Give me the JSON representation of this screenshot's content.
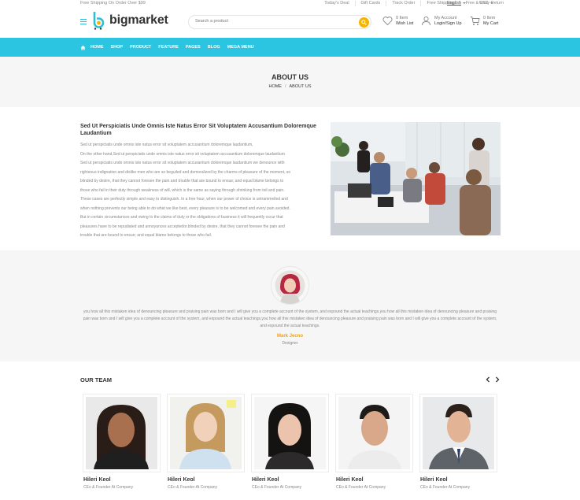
{
  "topbar": {
    "shipping": "Free Shipping On Order Over $99",
    "links": [
      "Today's Deal",
      "Gift Cards",
      "Track Order",
      "Free Shipping",
      "Free & Easy Return"
    ],
    "language": "English",
    "currency": "USD"
  },
  "header": {
    "logo": "bigmarket",
    "search_placeholder": "Search a product",
    "wishlist_count": "0 Item",
    "wishlist_label": "Wish List",
    "account_top": "My Account",
    "account_bottom": "Login/Sign Up",
    "cart_count": "0 Item",
    "cart_label": "My Cart"
  },
  "nav": [
    "HOME",
    "SHOP",
    "PRODUCT",
    "FEATURE",
    "PAGES",
    "BLOG",
    "MEGA MENU"
  ],
  "page": {
    "title": "ABOUT US",
    "breadcrumb_home": "HOME",
    "breadcrumb_sep": "/",
    "breadcrumb_current": "ABOUT US"
  },
  "about": {
    "heading": "Sed Ut Perspiciatis Unde Omnis Iste Natus Error Sit Voluptatem Accusantium Doloremque Laudantium",
    "lines": [
      "Sed ut perspiciatis unde omnis iste natus error sit voluptatem accusantium doloremque laudantium,",
      "On the other hand,Sed ut perspiciatis unde omnis iste natus error sit voluptatem accusantium doloremque laudantium",
      "Sed ut perspiciatis unde omnis iste natus error sit voluptatem accusantium doloremque laudantium we denounce with",
      "righteous indignation and dislike men who are so beguiled and demoralized by the charms of pleasure of the moment, so",
      "blinded by desire, that they cannot foresee the pain and trouble that are bound to ensue; and equal blame belongs to",
      "those who fail in their duty through weakness of will, which is the same as saying through shrinking from toil and pain.",
      "These cases are perfectly simple and easy to distinguish. In a free hour, when our power of choice is untrammelled and",
      "when nothing prevents our being able to do what we like best, every pleasure is to be welcomed and every pain avoided.",
      "But in certain circumstances and owing to the claims of duty or the obligations of business it will frequently occur that",
      "pleasures have to be repudiated and annoyances acceptedor.blinded by desire, that they cannot foresee the pain and",
      "trouble that are bound to ensue; and equal blame belongs to those who fail."
    ]
  },
  "testimonial": {
    "quote": "you how all this mistaken idea of denouncing pleasure and praising pain was born and I will give you a complete account of the system, and expound the actual teachings.you how all this mistaken idea of denouncing pleasure and praising pain was born and I will give you a complete account of the system, and expound the actual teachings.you how all this mistaken idea of denouncing pleasure and praising pain was born and I will give you a complete account of the system, and expound the actual teachings.",
    "author": "Mark Jecno",
    "role": "Designer"
  },
  "team": {
    "title": "OUR TEAM",
    "members": [
      {
        "name": "Hileri Keol",
        "position": "CEo & Founder At Company"
      },
      {
        "name": "Hileri Keol",
        "position": "CEo & Founder At Company"
      },
      {
        "name": "Hileri Keol",
        "position": "CEo & Founder At Company"
      },
      {
        "name": "Hileri Keol",
        "position": "CEo & Founder At Company"
      },
      {
        "name": "Hileri Keol",
        "position": "CEo & Founder At Company"
      }
    ]
  },
  "colors": {
    "accent": "#2bc4e1",
    "highlight": "#f5b400",
    "author": "#f5a300"
  }
}
